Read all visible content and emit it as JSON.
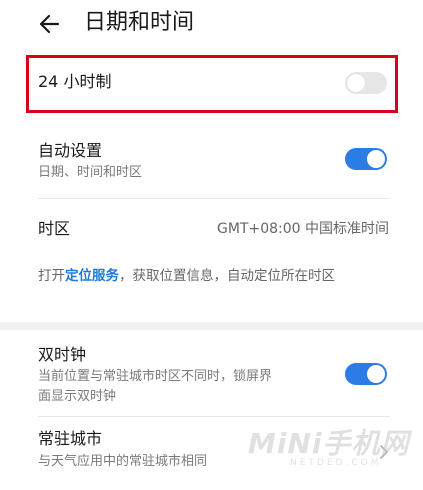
{
  "header": {
    "title": "日期和时间"
  },
  "rows": {
    "h24": {
      "label": "24 小时制",
      "toggle": "off"
    },
    "auto": {
      "label": "自动设置",
      "sub": "日期、时间和时区",
      "toggle": "on"
    },
    "timezone": {
      "label": "时区",
      "value": "GMT+08:00 中国标准时间"
    },
    "hint": {
      "prefix": "打开",
      "link": "定位服务",
      "suffix": "，获取位置信息，自动定位所在时区"
    },
    "dual": {
      "label": "双时钟",
      "sub_line1": "当前位置与常驻城市时区不同时，锁屏界",
      "sub_line2": "面显示双时钟",
      "toggle": "on"
    },
    "city": {
      "label": "常驻城市",
      "sub": "与天气应用中的常驻城市相同"
    }
  },
  "watermark": {
    "text": "MiNi手机网",
    "sub": "NETDED.COM"
  },
  "colors": {
    "accent": "#2c7ce5",
    "highlight": "#d9001b",
    "link": "#1f7bd8"
  }
}
